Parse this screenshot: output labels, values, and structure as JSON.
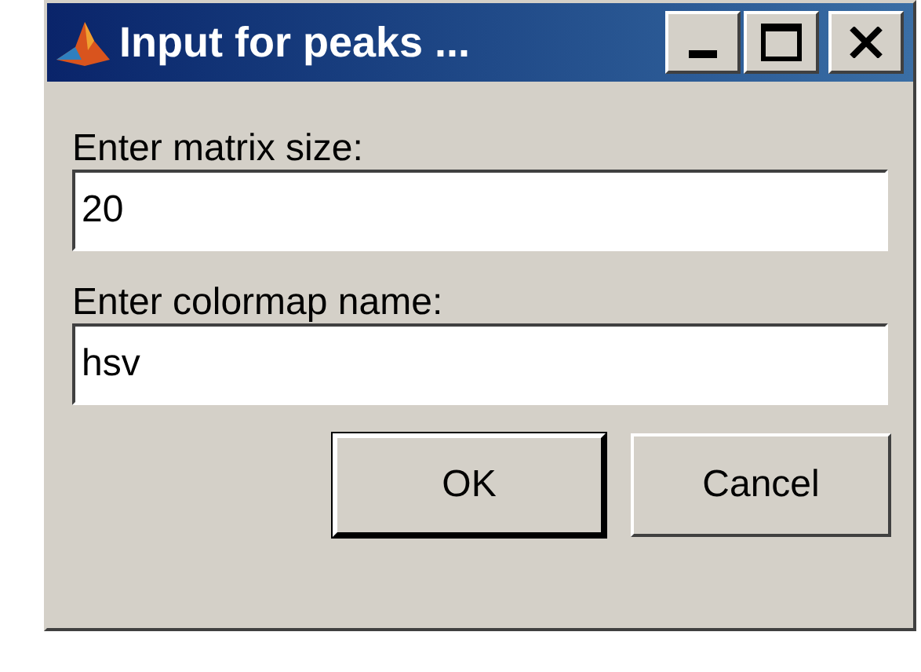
{
  "window": {
    "title": "Input for peaks ..."
  },
  "fields": [
    {
      "label": "Enter matrix size:",
      "value": "20"
    },
    {
      "label": "Enter colormap name:",
      "value": "hsv"
    }
  ],
  "buttons": [
    {
      "label": "OK",
      "default": true
    },
    {
      "label": "Cancel",
      "default": false
    }
  ]
}
